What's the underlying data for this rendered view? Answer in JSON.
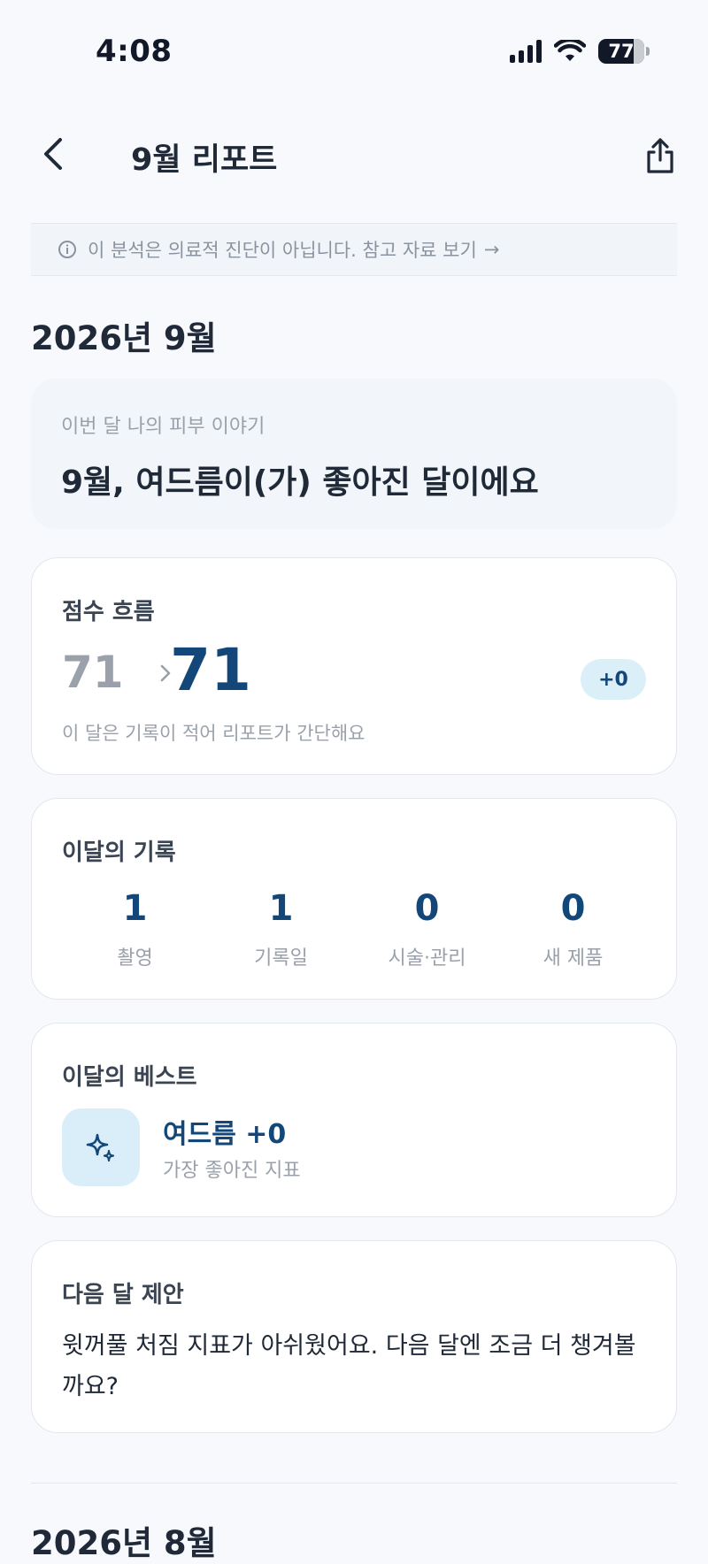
{
  "status_bar": {
    "time": "4:08",
    "battery": "77",
    "battery_level": 0.77
  },
  "header": {
    "title": "9월 리포트",
    "back_icon": "chevron-left-icon",
    "share_icon": "share-icon"
  },
  "disclaimer": {
    "icon": "info-icon",
    "text": "이 분석은 의료적 진단이 아닙니다. 참고 자료 보기",
    "arrow": "→"
  },
  "month_heading": "2026년 9월",
  "story": {
    "subtitle": "이번 달 나의 피부 이야기",
    "title": "9월, 여드름이(가) 좋아진 달이에요"
  },
  "score": {
    "label": "점수 흐름",
    "previous": "71",
    "current": "71",
    "delta": "+0",
    "note": "이 달은 기록이 적어 리포트가 간단해요"
  },
  "records": {
    "label": "이달의 기록",
    "items": [
      {
        "value": "1",
        "label": "촬영"
      },
      {
        "value": "1",
        "label": "기록일"
      },
      {
        "value": "0",
        "label": "시술·관리"
      },
      {
        "value": "0",
        "label": "새 제품"
      }
    ]
  },
  "best": {
    "label": "이달의 베스트",
    "icon": "sparkle-icon",
    "title": "여드름 +0",
    "subtitle": "가장 좋아진 지표"
  },
  "suggestion": {
    "label": "다음 달 제안",
    "text": "윗꺼풀 처짐 지표가 아쉬웠어요. 다음 달엔 조금 더 챙겨볼까요?"
  },
  "next_month_heading": "2026년 8월",
  "colors": {
    "background": "#f7f9fc",
    "accent": "#13477a",
    "accent_soft": "#dbeff8",
    "muted_text": "#9aa1ab"
  }
}
